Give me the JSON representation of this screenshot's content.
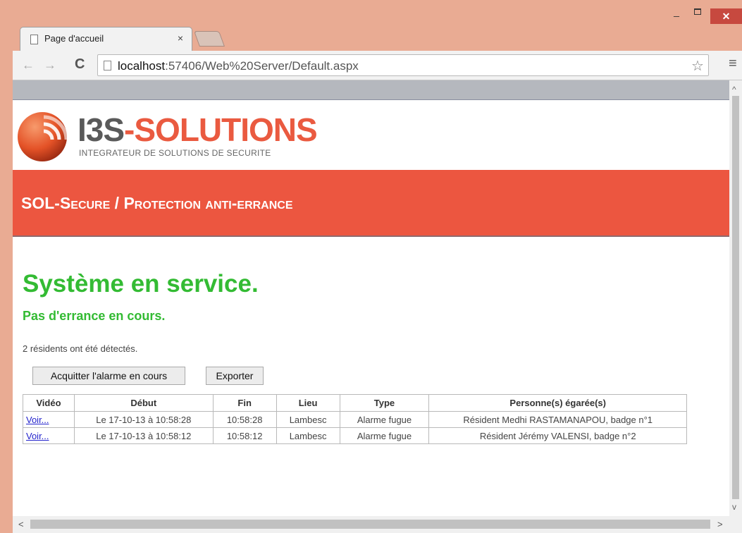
{
  "browser": {
    "tab_title": "Page d'accueil",
    "tab_close": "×",
    "window_controls": {
      "minimize": "_",
      "close": "✕"
    },
    "url_host": "localhost",
    "url_path": ":57406/Web%20Server/Default.aspx",
    "icons": {
      "back": "←",
      "forward": "→",
      "reload": "C",
      "star": "☆",
      "menu": "≡"
    }
  },
  "scrollbars": {
    "up": "^",
    "down": "v",
    "left": "<",
    "right": ">"
  },
  "header": {
    "brand_part1": "I3S",
    "brand_part2": "-SOLUTIONS",
    "tagline": "INTEGRATEUR DE SOLUTIONS DE SECURITE",
    "banner": "SOL-Secure / Protection anti-errance"
  },
  "main": {
    "status_title": "Système en service.",
    "status_sub": "Pas d'errance en cours.",
    "residents_count": "2 résidents ont été détectés.",
    "ack_button": "Acquitter l'alarme en cours",
    "export_button": "Exporter"
  },
  "table": {
    "headers": [
      "Vidéo",
      "Début",
      "Fin",
      "Lieu",
      "Type",
      "Personne(s) égarée(s)"
    ],
    "rows": [
      {
        "video": "Voir...",
        "debut": "Le 17-10-13 à 10:58:28",
        "fin": "10:58:28",
        "lieu": "Lambesc",
        "type": "Alarme fugue",
        "personne": "Résident Medhi RASTAMANAPOU, badge n°1"
      },
      {
        "video": "Voir...",
        "debut": "Le 17-10-13 à 10:58:12",
        "fin": "10:58:12",
        "lieu": "Lambesc",
        "type": "Alarme fugue",
        "personne": "Résident Jérémy VALENSI, badge n°2"
      }
    ]
  },
  "colors": {
    "brand_red": "#ec5640",
    "status_green": "#33bb33",
    "frame": "#e9ab93"
  }
}
